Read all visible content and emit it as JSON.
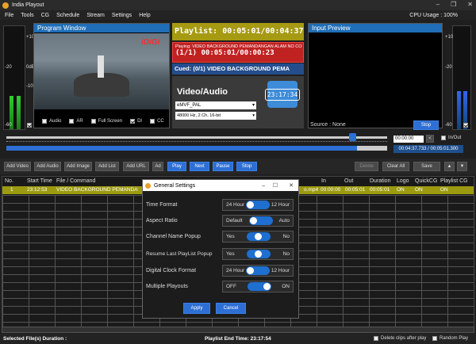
{
  "app": {
    "title": "India Playout",
    "cpu": "CPU Usage : 100%"
  },
  "menu": [
    "File",
    "Tools",
    "CG",
    "Schedule",
    "Stream",
    "Settings",
    "Help"
  ],
  "meters": {
    "ticks": [
      "+10",
      "0dB",
      "-10",
      "-20",
      "-30",
      "-40",
      "-50",
      "-60"
    ]
  },
  "program": {
    "title": "Program Window",
    "watermark": "iDiGi",
    "checks": [
      "Audio",
      "AR",
      "Full Screen",
      "DI",
      "CC"
    ]
  },
  "playlist": {
    "time": "Playlist: 00:05:01/00:04:37",
    "playing": "Playing: VIDEO BACKGROUND PEMANDANGAN ALAM NO CO",
    "counter": "(1/1) 00:05:01/00:00:23",
    "cued": "Cued: (0/1) VIDEO BACKGROUND PEMA"
  },
  "video_audio": {
    "title": "Video/Audio",
    "format": "eMVF_PAL",
    "audio": "48000 Hz, 2 Ch, 16-bit",
    "clock": "23:17:34"
  },
  "input_preview": {
    "title": "Input Preview",
    "source": "Source : None",
    "stop": "Stop"
  },
  "progress": {
    "timecode": "00:00:00",
    "inout_label": "In/Out",
    "position": "00:04:37.733 / 00:05:01.300",
    "fill": 0.92
  },
  "toolbar": {
    "add_video": "Add Video",
    "add_audio": "Add Audio",
    "add_image": "Add Image",
    "add_list": "Add List",
    "add_url": "Add URL",
    "ad": "Ad",
    "play": "Play",
    "next": "Next",
    "pause": "Pause",
    "stop": "Stop",
    "delete": "Delete",
    "clear_all": "Clear All",
    "save": "Save"
  },
  "table": {
    "headers": [
      "No.",
      "Start Time",
      "File / Command",
      "In",
      "Out",
      "Duration",
      "Logo",
      "QuickCG",
      "Playlist CG"
    ],
    "row": {
      "no": "1",
      "start": "23:12:53",
      "file": "VIDEO BACKGROUND PEMANDA",
      "file_tail": "o.mp4",
      "in": "00:00:00",
      "out": "00:05:01",
      "duration": "00:05:01",
      "logo": "ON",
      "quickcg": "ON",
      "playlistcg": "ON"
    }
  },
  "dialog": {
    "title": "General Settings",
    "rows": [
      {
        "label": "Time Format",
        "left": "24 Hour",
        "right": "12 Hour"
      },
      {
        "label": "Aspect Ratio",
        "left": "Default",
        "right": "Auto"
      },
      {
        "label": "Channel Name Popup",
        "left": "Yes",
        "right": "No"
      },
      {
        "label": "Resume Last PlayList Popup",
        "left": "Yes",
        "right": "No"
      },
      {
        "label": "Digital Clock Format",
        "left": "24 Hour",
        "right": "12 Hour"
      },
      {
        "label": "Multiple Playouts",
        "left": "OFF",
        "right": "ON"
      }
    ],
    "apply": "Apply",
    "cancel": "Cancel"
  },
  "status": {
    "selected": "Selected File(s) Duration :",
    "end_time": "Playlist End Time: 23:17:54",
    "delete_clips": "Delete clips after play",
    "random": "Random Play"
  }
}
